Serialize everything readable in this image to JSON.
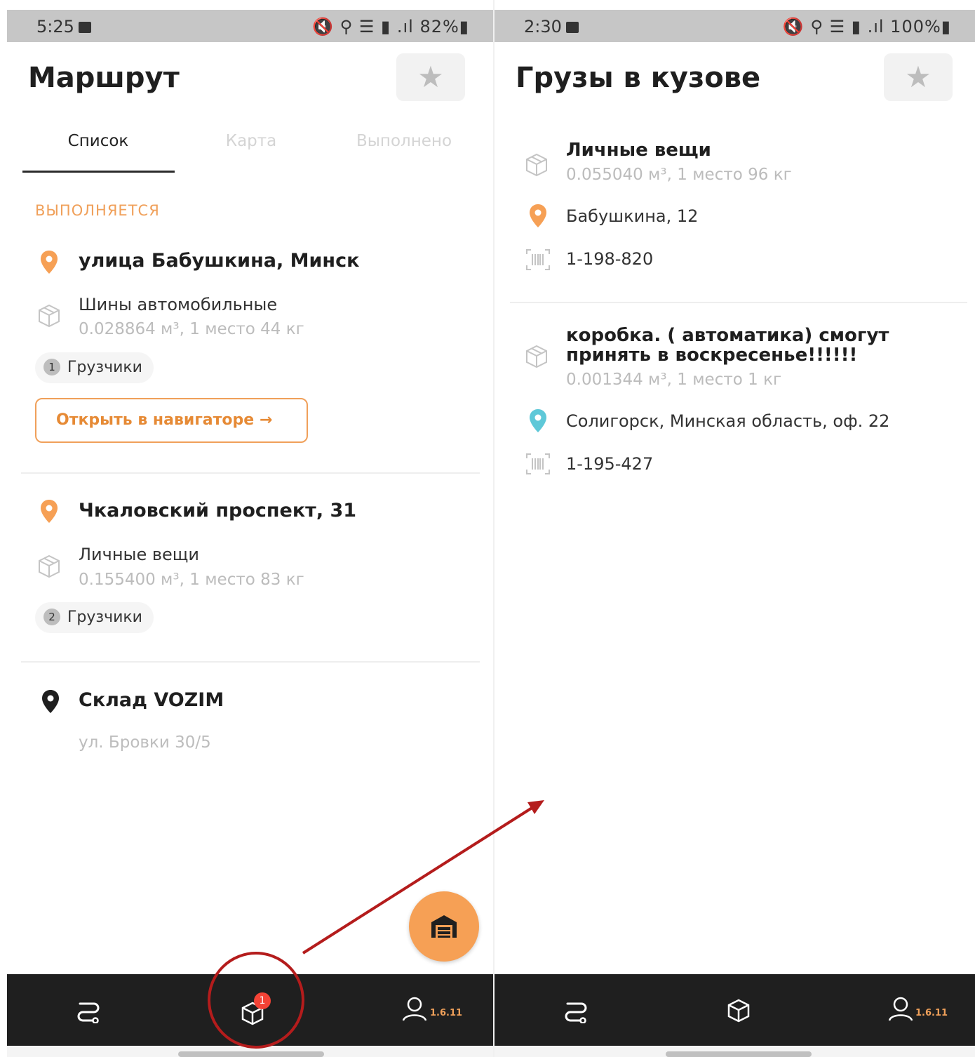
{
  "left": {
    "status": {
      "time": "5:25",
      "right": "🔇 ⚲ ☰ ▮ .ıl 82%▮"
    },
    "title": "Маршрут",
    "tabs": [
      {
        "label": "Список",
        "active": true
      },
      {
        "label": "Карта",
        "active": false
      },
      {
        "label": "Выполнено",
        "active": false
      }
    ],
    "section_label": "ВЫПОЛНЯЕТСЯ",
    "stops": [
      {
        "title": "улица Бабушкина, Минск",
        "cargo_name": "Шины автомобильные",
        "cargo_meta": "0.028864 м³, 1 место 44 кг",
        "chip_num": "1",
        "chip_label": "Грузчики",
        "pin_color": "#f6a055"
      },
      {
        "title": "Чкаловский проспект, 31",
        "cargo_name": "Личные вещи",
        "cargo_meta": "0.155400 м³, 1 место 83 кг",
        "chip_num": "2",
        "chip_label": "Грузчики",
        "pin_color": "#f6a055"
      }
    ],
    "nav_button": "Открыть в навигаторе →",
    "warehouse": {
      "title": "Склад VOZIM",
      "address": "ул. Бровки 30/5",
      "pin_color": "#1f1f1f"
    },
    "bottom": {
      "badge": "1",
      "version": "1.6.11"
    }
  },
  "right": {
    "status": {
      "time": "2:30",
      "right": "🔇 ⚲ ☰ ▮ .ıl 100%▮"
    },
    "title": "Грузы в кузове",
    "items": [
      {
        "name": "Личные вещи",
        "meta": "0.055040 м³, 1 место 96 кг",
        "address": "Бабушкина, 12",
        "code": "1-198-820",
        "pin_color": "#f6a055"
      },
      {
        "name_line1": "коробка. ( автоматика) смогут",
        "name_line2": "принять в воскресенье!!!!!!",
        "meta": "0.001344 м³, 1 место 1 кг",
        "address": "Солигорск, Минская область, оф. 22",
        "code": "1-195-427",
        "pin_color": "#5ec8d8"
      }
    ],
    "bottom": {
      "version": "1.6.11"
    }
  },
  "colors": {
    "accent": "#f0a05a",
    "dark_bar": "#1f1f1f",
    "annotation": "#b41c1c",
    "badge": "#f44336"
  }
}
